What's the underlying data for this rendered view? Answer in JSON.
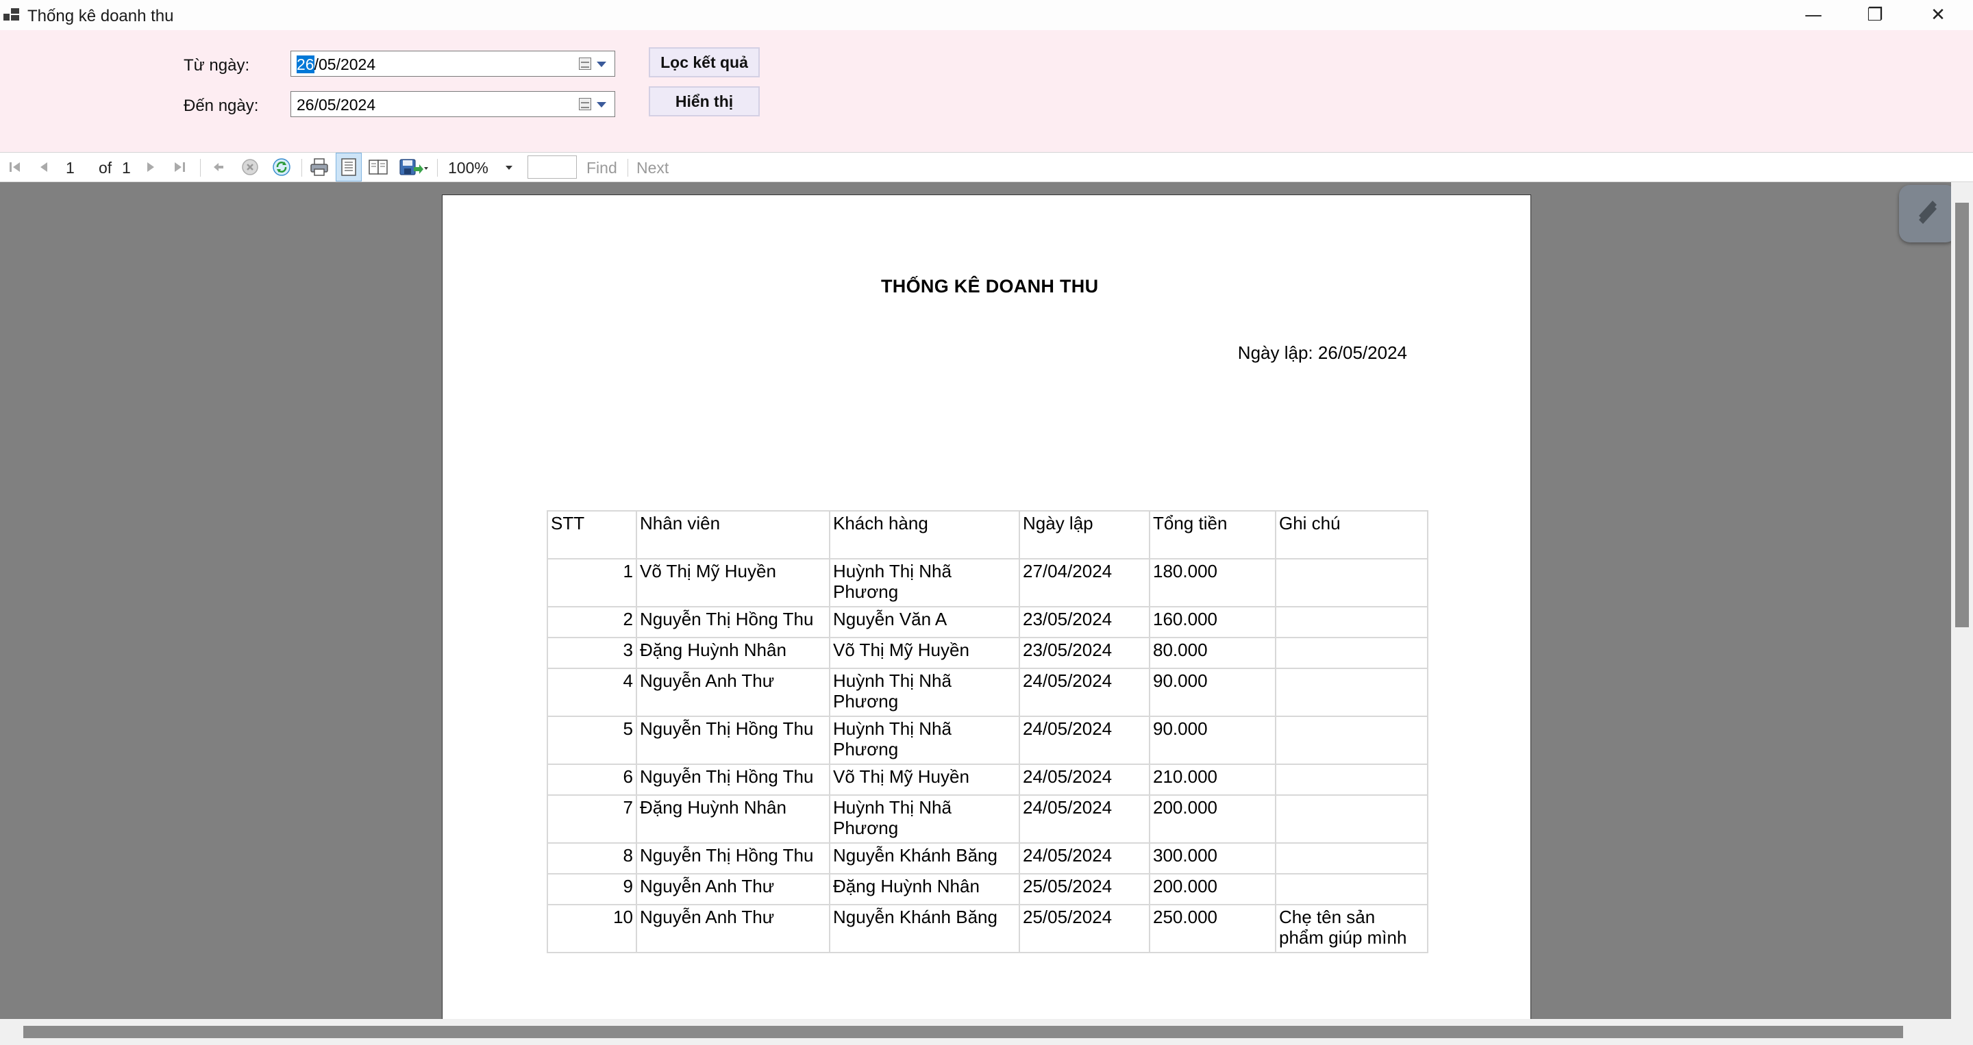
{
  "window": {
    "title": "Thống kê doanh thu",
    "icon": "app-window-icon",
    "minimize_glyph": "—",
    "maximize_glyph": "❐",
    "close_glyph": "✕"
  },
  "filter": {
    "from_label": "Từ ngày:",
    "to_label": "Đến ngày:",
    "from_day_selected": "26",
    "from_rest": "/05/2024",
    "to_value": "26/05/2024",
    "filter_button": "Lọc kết quả",
    "show_button": "Hiển thị",
    "background_color": "#fdedf2"
  },
  "toolbar": {
    "current_page": "1",
    "of_label": "of",
    "total_pages": "1",
    "zoom": "100%",
    "find_label": "Find",
    "next_label": "Next",
    "icons": [
      "first-page-icon",
      "previous-page-icon",
      "next-page-icon",
      "last-page-icon",
      "back-icon",
      "stop-icon",
      "refresh-icon",
      "print-icon",
      "print-layout-icon",
      "page-setup-icon",
      "export-icon"
    ]
  },
  "report": {
    "title": "THỐNG KÊ DOANH THU",
    "date_label": "Ngày lập: 26/05/2024",
    "columns": [
      "STT",
      "Nhân viên",
      "Khách hàng",
      "Ngày lập",
      "Tổng tiền",
      "Ghi chú"
    ],
    "rows": [
      {
        "stt": "1",
        "nhan_vien": "Võ Thị Mỹ Huyền",
        "khach_hang": "Huỳnh Thị Nhã Phương",
        "ngay_lap": "27/04/2024",
        "tong_tien": "180.000",
        "ghi_chu": ""
      },
      {
        "stt": "2",
        "nhan_vien": "Nguyễn Thị Hồng Thu",
        "khach_hang": "Nguyễn Văn A",
        "ngay_lap": "23/05/2024",
        "tong_tien": "160.000",
        "ghi_chu": ""
      },
      {
        "stt": "3",
        "nhan_vien": "Đặng Huỳnh Nhân",
        "khach_hang": "Võ Thị Mỹ Huyền",
        "ngay_lap": "23/05/2024",
        "tong_tien": "80.000",
        "ghi_chu": ""
      },
      {
        "stt": "4",
        "nhan_vien": "Nguyễn Anh Thư",
        "khach_hang": "Huỳnh Thị Nhã Phương",
        "ngay_lap": "24/05/2024",
        "tong_tien": "90.000",
        "ghi_chu": ""
      },
      {
        "stt": "5",
        "nhan_vien": "Nguyễn Thị Hồng Thu",
        "khach_hang": "Huỳnh Thị Nhã Phương",
        "ngay_lap": "24/05/2024",
        "tong_tien": "90.000",
        "ghi_chu": ""
      },
      {
        "stt": "6",
        "nhan_vien": "Nguyễn Thị Hồng Thu",
        "khach_hang": "Võ Thị Mỹ Huyền",
        "ngay_lap": "24/05/2024",
        "tong_tien": "210.000",
        "ghi_chu": ""
      },
      {
        "stt": "7",
        "nhan_vien": "Đặng Huỳnh Nhân",
        "khach_hang": "Huỳnh Thị Nhã Phương",
        "ngay_lap": "24/05/2024",
        "tong_tien": "200.000",
        "ghi_chu": ""
      },
      {
        "stt": "8",
        "nhan_vien": "Nguyễn Thị Hồng Thu",
        "khach_hang": "Nguyễn Khánh Băng",
        "ngay_lap": "24/05/2024",
        "tong_tien": "300.000",
        "ghi_chu": ""
      },
      {
        "stt": "9",
        "nhan_vien": "Nguyễn Anh Thư",
        "khach_hang": "Đặng Huỳnh Nhân",
        "ngay_lap": "25/05/2024",
        "tong_tien": "200.000",
        "ghi_chu": ""
      },
      {
        "stt": "10",
        "nhan_vien": "Nguyễn Anh Thư",
        "khach_hang": "Nguyễn Khánh Băng",
        "ngay_lap": "25/05/2024",
        "tong_tien": "250.000",
        "ghi_chu": "Chẹ tên sản phẩm giúp mình"
      }
    ]
  },
  "colors": {
    "viewer_background": "#808080",
    "selection": "#0078d7",
    "button_background": "#eeeaf7"
  }
}
